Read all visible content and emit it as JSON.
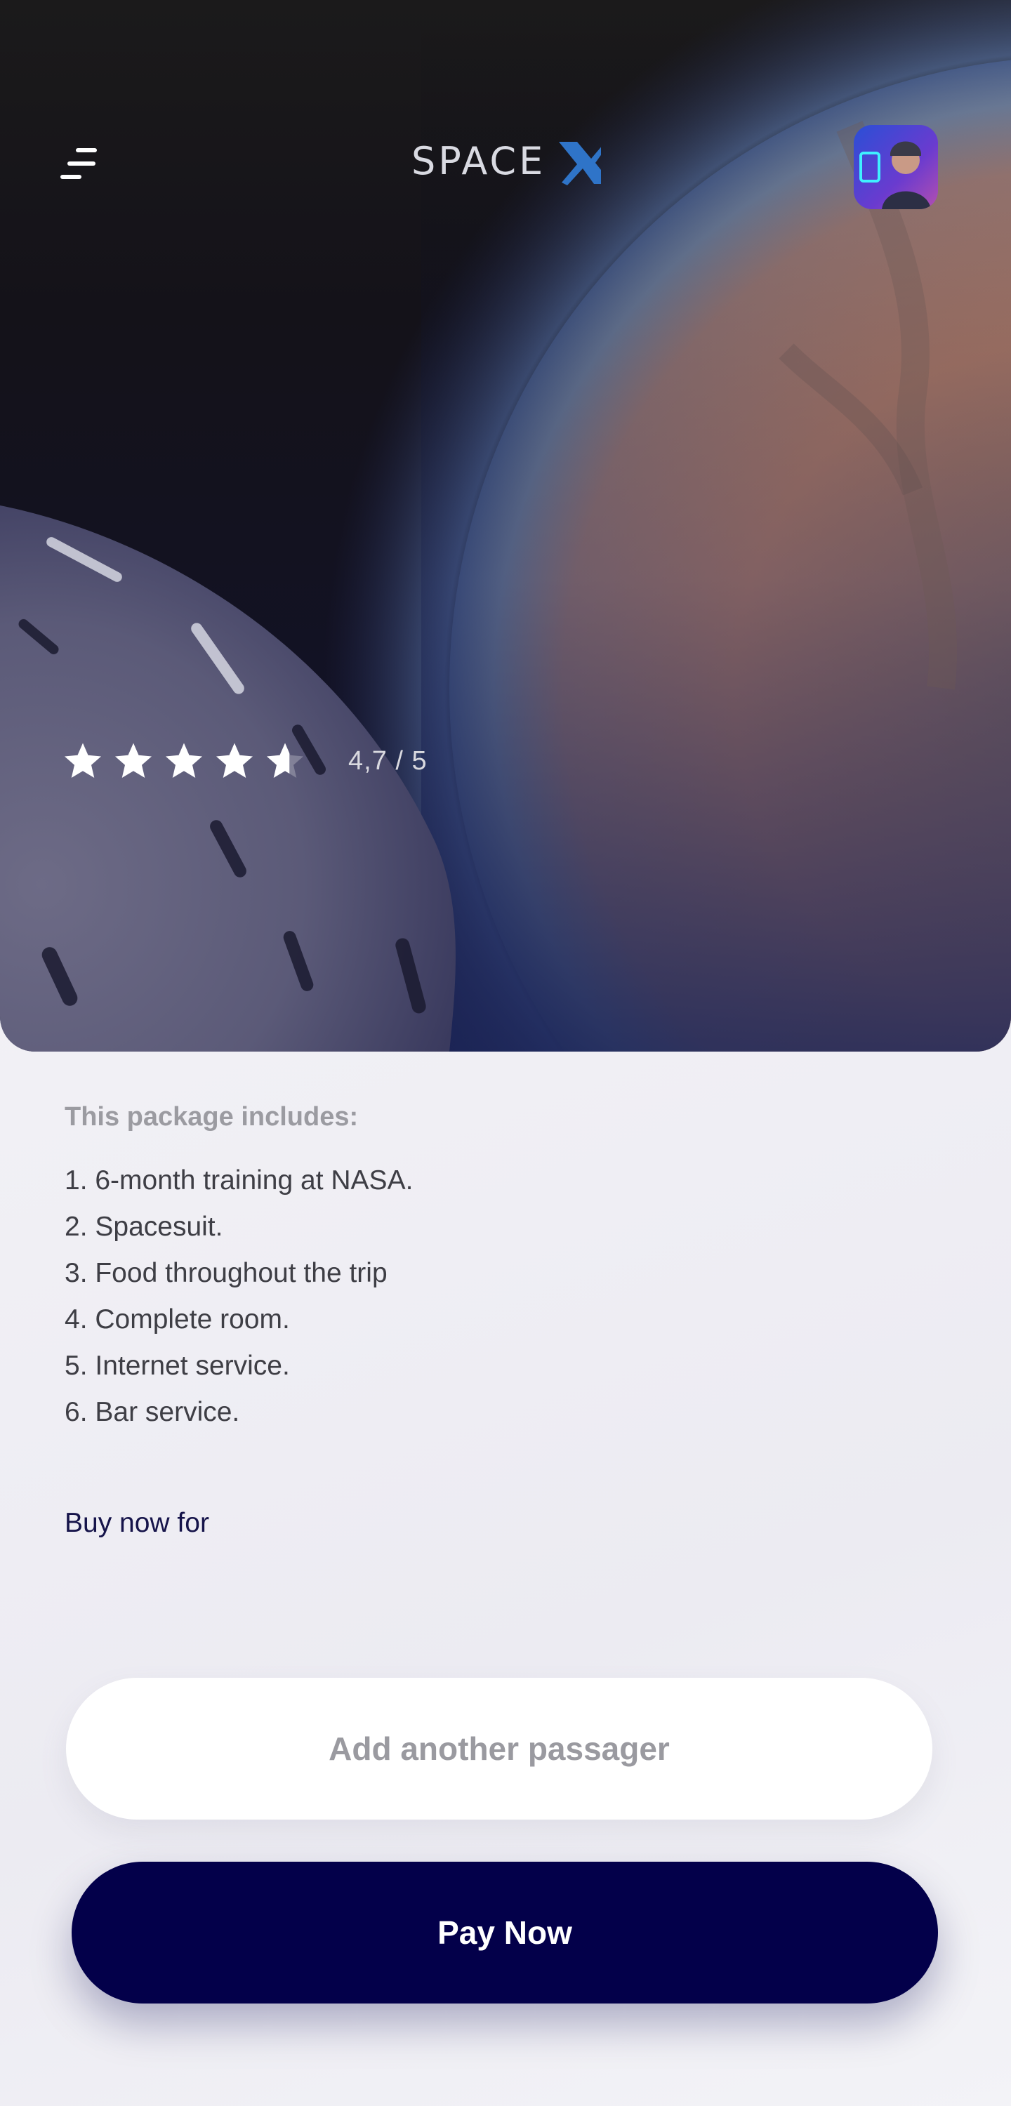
{
  "header": {
    "brand": "SPACE X",
    "menu_icon": "menu-icon",
    "avatar_icon": "user-avatar"
  },
  "rating": {
    "value": 4.7,
    "max": 5,
    "text": "4,7 / 5"
  },
  "package": {
    "title": "This package includes:",
    "items": [
      "1. 6-month training at NASA.",
      "2. Spacesuit.",
      "3. Food throughout the trip",
      "4. Complete room.",
      "5. Internet service.",
      "6. Bar service."
    ]
  },
  "buy": {
    "label": "Buy now for"
  },
  "actions": {
    "add_passenger_label": "Add another passager",
    "pay_label": "Pay Now"
  },
  "colors": {
    "primary": "#03004a",
    "secondary_text": "#9a9aa0",
    "background": "#f3f3f7"
  }
}
